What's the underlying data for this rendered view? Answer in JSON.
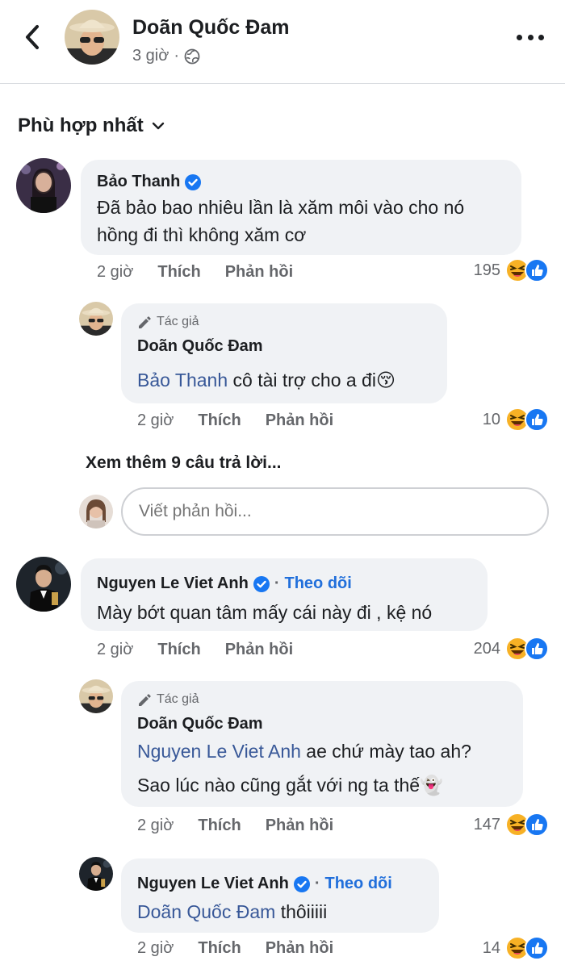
{
  "header": {
    "name": "Doãn Quốc Đam",
    "time": "3 giờ",
    "privacy_icon": "globe-icon"
  },
  "sort": {
    "label": "Phù hợp nhất"
  },
  "comments": [
    {
      "name": "Bảo Thanh",
      "verified": true,
      "text_line1": "Đã bảo bao nhiêu lần là xăm môi vào cho nó",
      "text_line2": "hồng đi thì không xăm cơ",
      "time": "2 giờ",
      "like": "Thích",
      "reply": "Phản hồi",
      "reactions": "195",
      "reaction_icons": [
        "haha-icon",
        "like-icon"
      ],
      "replies": [
        {
          "badge": "Tác giả",
          "name": "Doãn Quốc Đam",
          "mention": "Bảo Thanh",
          "text": " cô tài trợ cho a đi😚",
          "time": "2 giờ",
          "like": "Thích",
          "reply": "Phản hồi",
          "reactions": "10"
        }
      ],
      "more_replies": "Xem thêm 9 câu trả lời...",
      "reply_placeholder": "Viết phản hồi..."
    },
    {
      "name": "Nguyen Le Viet Anh",
      "verified": true,
      "follow": "Theo dõi",
      "text_line1": "Mày bớt quan tâm mấy cái này đi , kệ nó",
      "time": "2 giờ",
      "like": "Thích",
      "reply": "Phản hồi",
      "reactions": "204",
      "replies": [
        {
          "badge": "Tác giả",
          "name": "Doãn Quốc Đam",
          "mention": "Nguyen Le Viet Anh",
          "text": " ae chứ mày tao ah?",
          "text_line2": "Sao lúc nào cũng gắt với ng ta thế👻",
          "time": "2 giờ",
          "like": "Thích",
          "reply": "Phản hồi",
          "reactions": "147"
        },
        {
          "name": "Nguyen Le Viet Anh",
          "verified": true,
          "follow": "Theo dõi",
          "mention": "Doãn Quốc Đam",
          "text": " thôiiiii",
          "time": "2 giờ",
          "like": "Thích",
          "reply": "Phản hồi",
          "reactions": "14"
        }
      ]
    }
  ],
  "colors": {
    "accent": "#216fdb",
    "mention": "#385898",
    "bubble": "#f0f2f5",
    "secondary_text": "#65676b"
  }
}
